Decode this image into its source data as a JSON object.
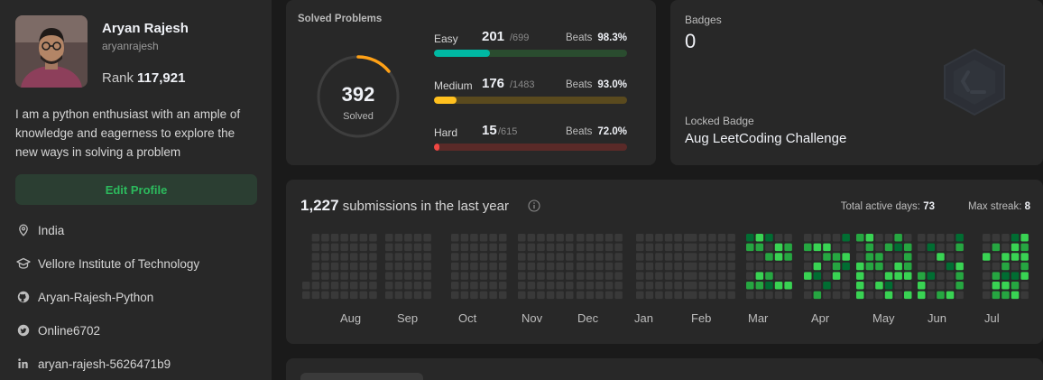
{
  "profile": {
    "name": "Aryan Rajesh",
    "username": "aryanrajesh",
    "rank_label": "Rank",
    "rank_value": "117,921",
    "bio": "I am a python enthusiast with an ample of knowledge and eagerness to explore the new ways in solving a problem",
    "edit_label": "Edit Profile",
    "location": "India",
    "school": "Vellore Institute of Technology",
    "github": "Aryan-Rajesh-Python",
    "twitter": "Online6702",
    "linkedin": "aryan-rajesh-5626471b9"
  },
  "solved": {
    "title": "Solved Problems",
    "total": "392",
    "total_label": "Solved",
    "ring_fraction": 0.14,
    "difficulties": [
      {
        "name": "Easy",
        "count": "201",
        "total": "/699",
        "beats_label": "Beats",
        "beats": "98.3%",
        "fraction": 0.2876,
        "color": "#00b8a3",
        "track": "#2a4c2f"
      },
      {
        "name": "Medium",
        "count": "176",
        "total": "/1483",
        "beats_label": "Beats",
        "beats": "93.0%",
        "fraction": 0.1187,
        "color": "#ffc01e",
        "track": "#5a4a1e"
      },
      {
        "name": "Hard",
        "count": "15",
        "total": "/615",
        "beats_label": "Beats",
        "beats": "72.0%",
        "fraction": 0.0244,
        "color": "#ef4743",
        "track": "#5a2a28"
      }
    ]
  },
  "badges": {
    "label": "Badges",
    "count": "0",
    "locked_label": "Locked Badge",
    "locked_name": "Aug LeetCoding Challenge"
  },
  "submissions": {
    "count": "1,227",
    "suffix": "submissions in the last year",
    "active_days_label": "Total active days:",
    "active_days": "73",
    "max_streak_label": "Max streak:",
    "max_streak": "8",
    "months": [
      "Aug",
      "Sep",
      "Oct",
      "Nov",
      "Dec",
      "Jan",
      "Feb",
      "Mar",
      "Apr",
      "May",
      "Jun",
      "Jul"
    ]
  },
  "colors": {
    "bg": "#1a1a1a",
    "card": "#282828",
    "green": "#2cbb5d",
    "cell_empty": "#393939"
  }
}
